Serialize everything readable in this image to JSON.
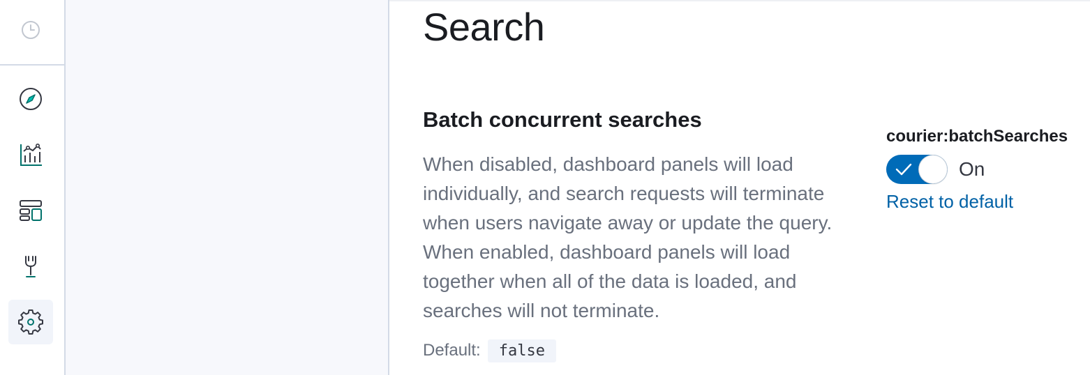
{
  "nav": {
    "icons": [
      {
        "name": "clock-icon"
      },
      {
        "name": "compass-icon"
      },
      {
        "name": "chart-icon"
      },
      {
        "name": "dashboard-icon"
      },
      {
        "name": "wrench-icon"
      },
      {
        "name": "gear-icon",
        "active": true
      }
    ]
  },
  "colors": {
    "accent": "#006bb8",
    "link": "#0061a6",
    "icon_green": "#00726b",
    "text": "#1a1c21",
    "muted": "#69707d"
  },
  "section": {
    "title": "Search"
  },
  "setting": {
    "title": "Batch concurrent searches",
    "description": "When disabled, dashboard panels will load individually, and search requests will terminate when users navigate away or update the query. When enabled, dashboard panels will load together when all of the data is loaded, and searches will not terminate.",
    "default_label": "Default:",
    "default_value": "false",
    "key": "courier:batchSearches",
    "toggle_state": true,
    "toggle_label": "On",
    "reset_label": "Reset to default"
  }
}
